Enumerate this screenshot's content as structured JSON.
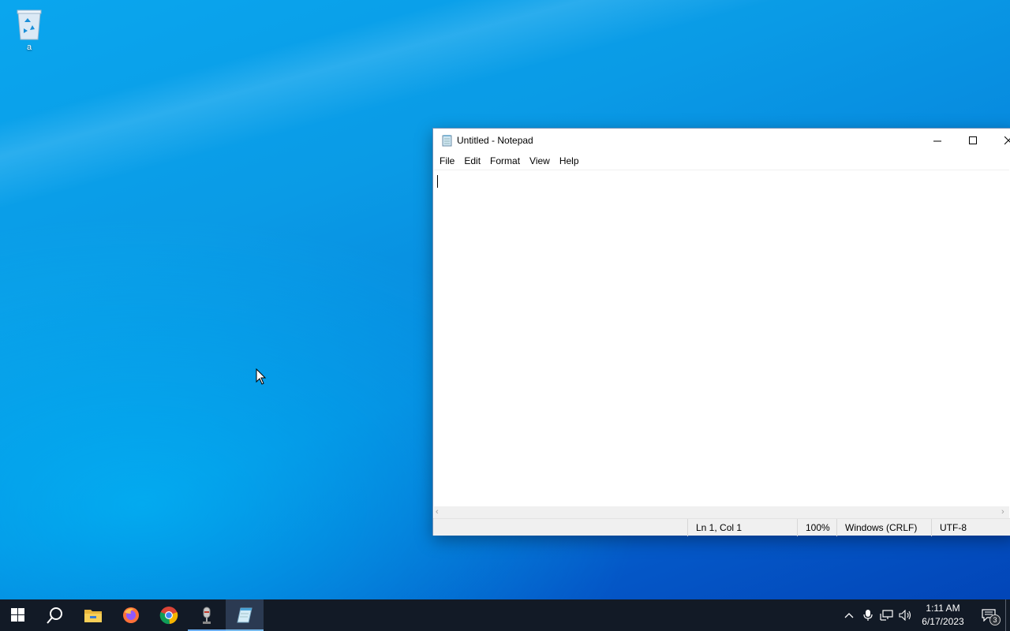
{
  "desktop": {
    "icons": [
      {
        "label": "a",
        "icon": "recycle-bin-icon"
      }
    ]
  },
  "notepad": {
    "title": "Untitled - Notepad",
    "menu": [
      "File",
      "Edit",
      "Format",
      "View",
      "Help"
    ],
    "content": "",
    "status": {
      "position": "Ln 1, Col 1",
      "zoom": "100%",
      "line_ending": "Windows (CRLF)",
      "encoding": "UTF-8"
    }
  },
  "taskbar": {
    "pinned": [
      {
        "name": "start",
        "icon": "windows-logo-icon"
      },
      {
        "name": "search",
        "icon": "search-icon"
      },
      {
        "name": "file-explorer",
        "icon": "folder-icon"
      },
      {
        "name": "firefox",
        "icon": "firefox-icon"
      },
      {
        "name": "chrome",
        "icon": "chrome-icon"
      },
      {
        "name": "recorder",
        "icon": "microphone-app-icon"
      },
      {
        "name": "notepad",
        "icon": "notepad-icon",
        "active": true
      }
    ],
    "clock": {
      "time": "1:11 AM",
      "date": "6/17/2023"
    },
    "notifications_count": "3"
  },
  "colors": {
    "taskbar": "#121a26",
    "accent": "#76b9ed",
    "desktop": "#0a9be6"
  }
}
